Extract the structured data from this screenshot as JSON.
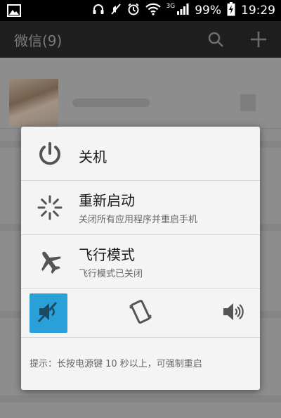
{
  "status_bar": {
    "network": "3G",
    "battery": "99%",
    "time": "19:29"
  },
  "app_bar": {
    "title": "微信(9)"
  },
  "power_menu": {
    "items": [
      {
        "label": "关机",
        "subtitle": "",
        "icon": "power-icon"
      },
      {
        "label": "重新启动",
        "subtitle": "关闭所有应用程序并重启手机",
        "icon": "restart-icon"
      },
      {
        "label": "飞行模式",
        "subtitle": "飞行模式已关闭",
        "icon": "airplane-icon"
      }
    ],
    "sound_modes": [
      {
        "name": "silent",
        "icon": "mute-speaker-icon",
        "active": true
      },
      {
        "name": "vibrate",
        "icon": "vibrate-phone-icon",
        "active": false
      },
      {
        "name": "sound",
        "icon": "speaker-icon",
        "active": false
      }
    ],
    "hint": "提示：长按电源键 10 秒以上，可强制重启"
  },
  "colors": {
    "accent": "#2aa0d8",
    "dialog_bg": "#f4f4f4",
    "statusbar_bg": "#000000"
  }
}
